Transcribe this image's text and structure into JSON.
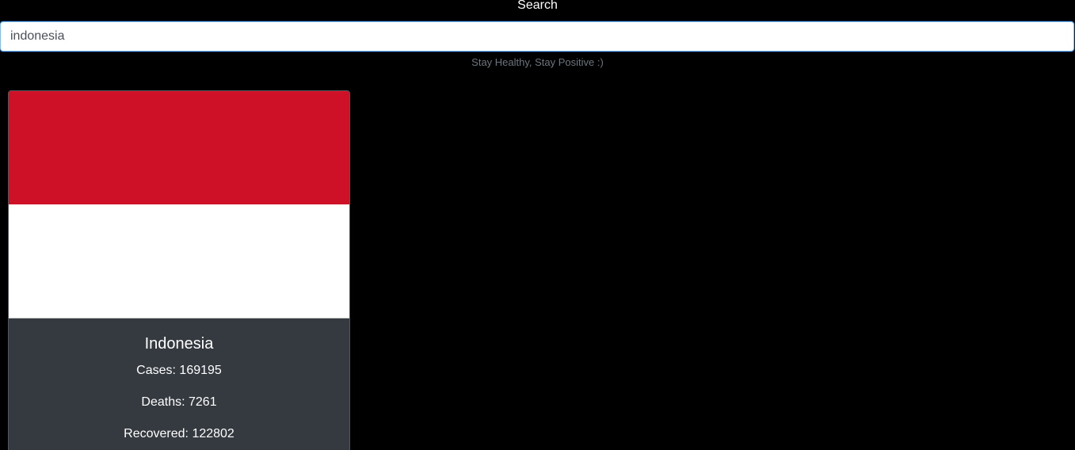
{
  "header": {
    "label": "Search"
  },
  "search": {
    "value": "indonesia",
    "placeholder": ""
  },
  "tagline": "Stay Healthy, Stay Positive :)",
  "country_card": {
    "name": "Indonesia",
    "flag": {
      "icon": "indonesia-flag-icon",
      "top_color": "#ce1126",
      "bottom_color": "#ffffff"
    },
    "cases": "Cases: 169195",
    "deaths": "Deaths: 7261",
    "recovered": "Recovered: 122802"
  },
  "colors": {
    "background": "#000000",
    "card_background": "#343a40",
    "input_focus_border": "#80bdff",
    "tagline_text": "#6c757d"
  }
}
